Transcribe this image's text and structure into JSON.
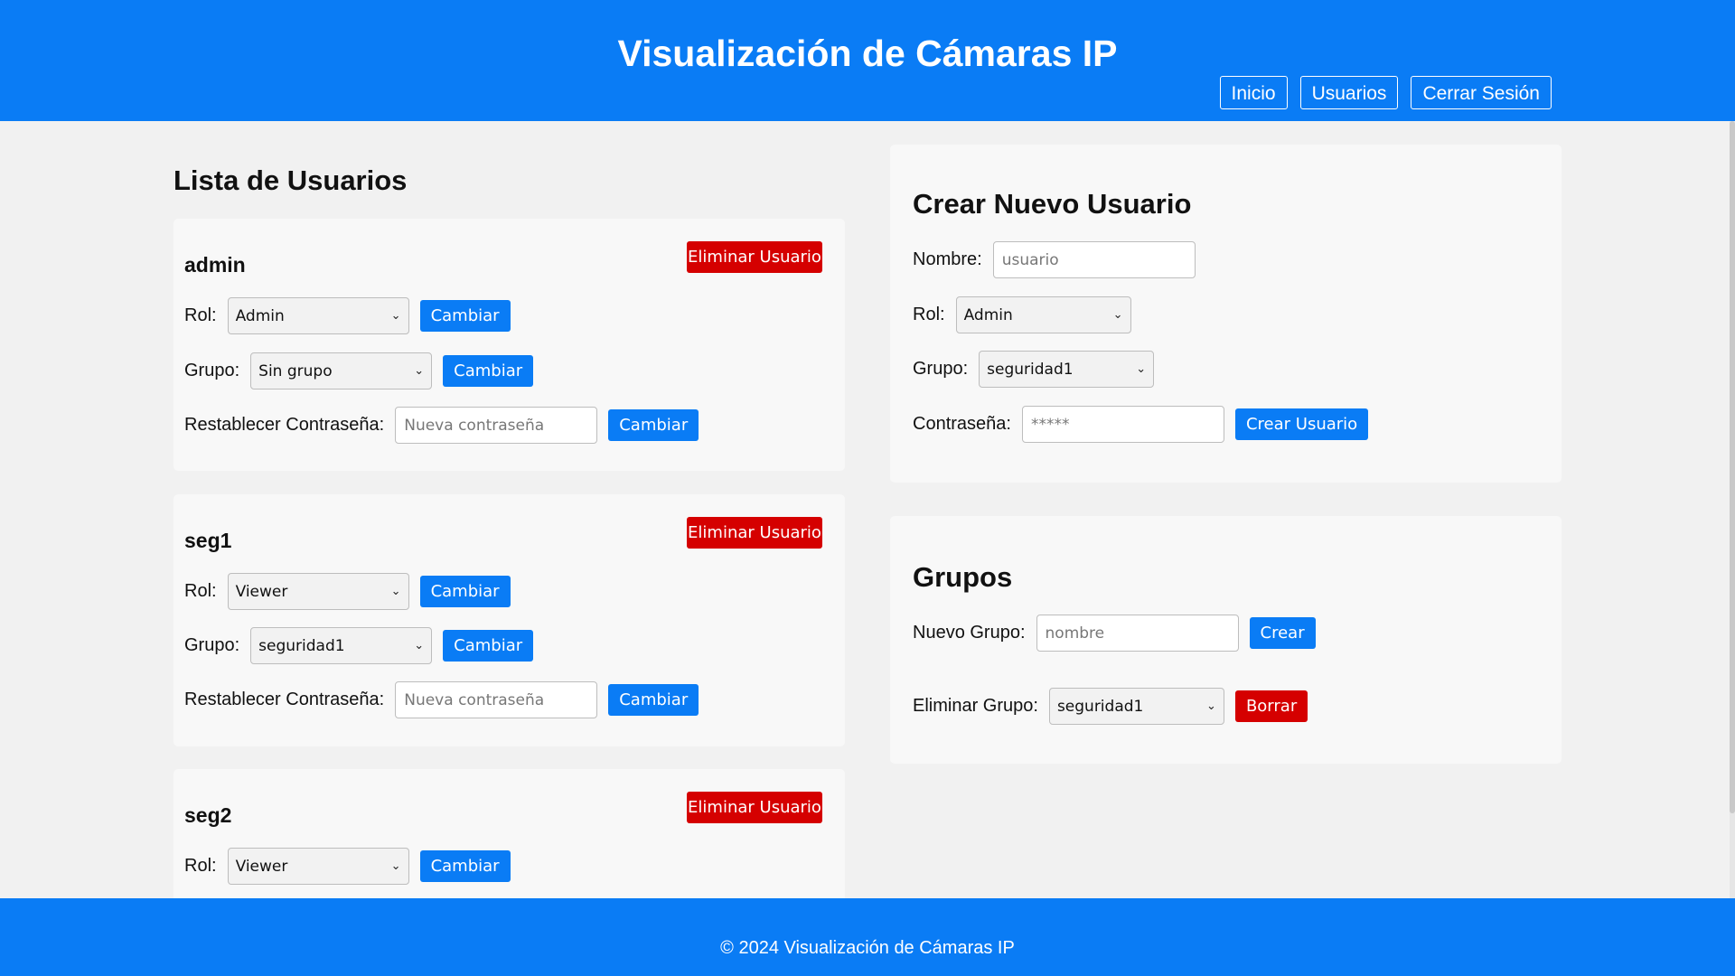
{
  "header": {
    "title": "Visualización de Cámaras IP",
    "nav": [
      "Inicio",
      "Usuarios",
      "Cerrar Sesión"
    ]
  },
  "users_section": {
    "title": "Lista de Usuarios",
    "delete_label": "Eliminar Usuario",
    "role_label": "Rol:",
    "group_label": "Grupo:",
    "reset_label": "Restablecer Contraseña:",
    "reset_placeholder": "Nueva contraseña",
    "change_label": "Cambiar",
    "users": [
      {
        "name": "admin",
        "role": "Admin",
        "group": "Sin grupo"
      },
      {
        "name": "seg1",
        "role": "Viewer",
        "group": "seguridad1"
      },
      {
        "name": "seg2",
        "role": "Viewer",
        "group": ""
      }
    ]
  },
  "create_user": {
    "title": "Crear Nuevo Usuario",
    "name_label": "Nombre:",
    "name_placeholder": "usuario",
    "role_label": "Rol:",
    "role_value": "Admin",
    "group_label": "Grupo:",
    "group_value": "seguridad1",
    "password_label": "Contraseña:",
    "password_placeholder": "*****",
    "submit_label": "Crear Usuario"
  },
  "groups": {
    "title": "Grupos",
    "new_label": "Nuevo Grupo:",
    "new_placeholder": "nombre",
    "create_label": "Crear",
    "delete_label": "Eliminar Grupo:",
    "delete_value": "seguridad1",
    "delete_button": "Borrar"
  },
  "footer": {
    "text": "© 2024 Visualización de Cámaras IP"
  }
}
